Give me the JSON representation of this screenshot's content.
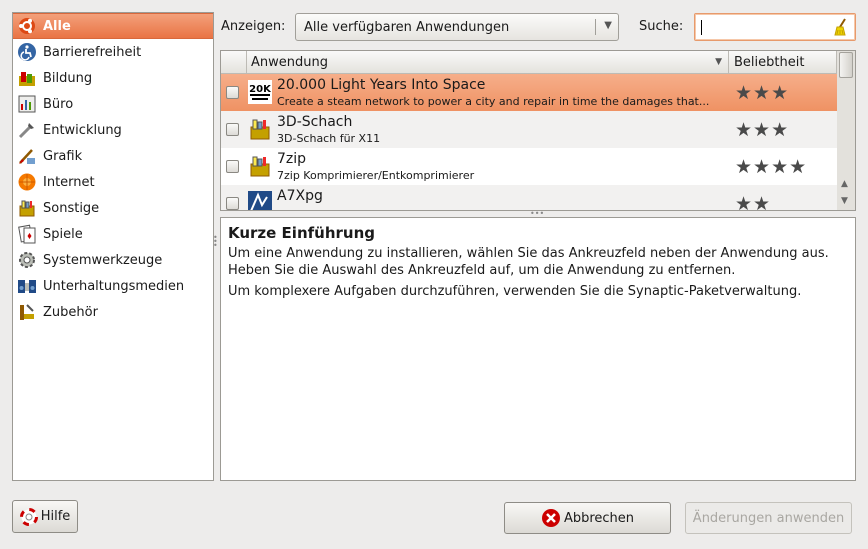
{
  "sidebar": {
    "items": [
      {
        "label": "Alle",
        "icon": "ubuntu-icon",
        "selected": true
      },
      {
        "label": "Barrierefreiheit",
        "icon": "accessibility-icon"
      },
      {
        "label": "Bildung",
        "icon": "education-icon"
      },
      {
        "label": "Büro",
        "icon": "office-icon"
      },
      {
        "label": "Entwicklung",
        "icon": "development-icon"
      },
      {
        "label": "Grafik",
        "icon": "graphics-icon"
      },
      {
        "label": "Internet",
        "icon": "internet-icon"
      },
      {
        "label": "Sonstige",
        "icon": "other-icon"
      },
      {
        "label": "Spiele",
        "icon": "games-icon"
      },
      {
        "label": "Systemwerkzeuge",
        "icon": "system-tools-icon"
      },
      {
        "label": "Unterhaltungsmedien",
        "icon": "multimedia-icon"
      },
      {
        "label": "Zubehör",
        "icon": "accessories-icon"
      }
    ]
  },
  "toolbar": {
    "show_label": "Anzeigen:",
    "show_value": "Alle verfügbaren Anwendungen",
    "search_label": "Suche:",
    "search_value": ""
  },
  "table": {
    "headers": {
      "app": "Anwendung",
      "popularity": "Beliebtheit"
    },
    "rows": [
      {
        "name": "20.000 Light Years Into Space",
        "desc": "Create a steam network to power a city and repair in time the damages that...",
        "stars": "★★★",
        "rating": 3,
        "icon": "lightyears-icon",
        "icon_text": "20K",
        "selected": true
      },
      {
        "name": "3D-Schach",
        "desc": "3D-Schach für X11",
        "stars": "★★★",
        "rating": 3,
        "icon": "chess-package-icon"
      },
      {
        "name": "7zip",
        "desc": "7zip Komprimierer/Entkomprimierer",
        "stars": "★★★★",
        "rating": 4,
        "icon": "archive-package-icon"
      },
      {
        "name": "A7Xpg",
        "desc": "",
        "stars": "★★",
        "rating": 2,
        "icon": "a7xpg-icon"
      }
    ]
  },
  "description": {
    "title": "Kurze Einführung",
    "lines": [
      "Um eine Anwendung zu installieren, wählen Sie das Ankreuzfeld neben der Anwendung aus.",
      "Heben Sie die Auswahl des Ankreuzfeld auf, um die Anwendung zu entfernen.",
      "Um komplexere Aufgaben durchzuführen, verwenden Sie die Synaptic-Paketverwaltung."
    ]
  },
  "buttons": {
    "help": "Hilfe",
    "cancel": "Abbrechen",
    "apply": "Änderungen anwenden"
  },
  "colors": {
    "selection": "#ef9263",
    "accent": "#e97445"
  }
}
